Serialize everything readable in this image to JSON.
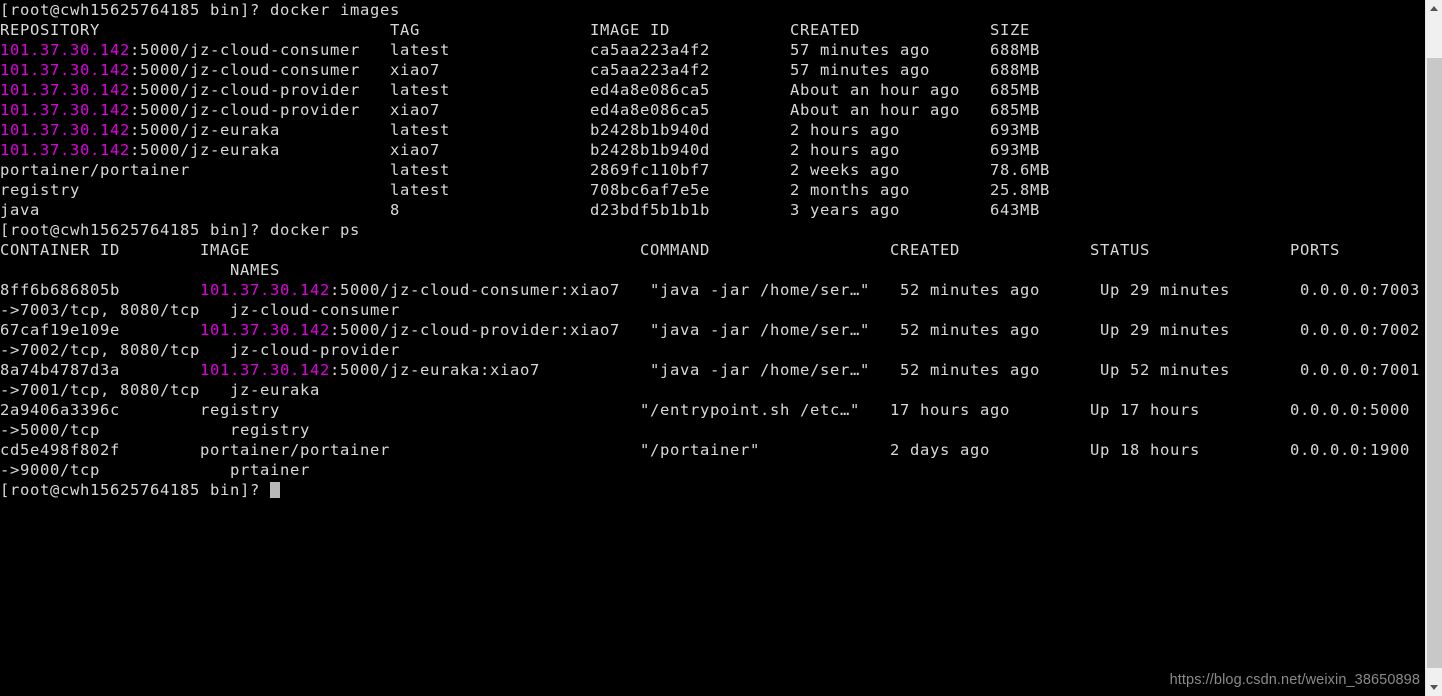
{
  "window": {
    "background_color": "#000000",
    "foreground_color": "#d8d8d8",
    "highlight_color": "#e000e0"
  },
  "watermark": {
    "text": "https://blog.csdn.net/weixin_38650898"
  },
  "scrollbar": {
    "up_arrow": "chevron-up-icon",
    "down_arrow": "chevron-down-icon"
  },
  "terminal": {
    "prompt": "[root@cwh15625764185 bin]?",
    "lines": [
      {
        "id": "cmd-docker-images",
        "segments": [
          {
            "text": "[root@cwh15625764185 bin]? docker images",
            "color": "plain"
          }
        ]
      },
      {
        "id": "images-header",
        "segments": [
          {
            "text": "REPOSITORY                             TAG                 IMAGE ID            CREATED             SIZE",
            "color": "plain"
          }
        ]
      },
      {
        "id": "images-row-1",
        "segments": [
          {
            "text": "101.37.30.142",
            "color": "magenta"
          },
          {
            "text": ":5000/jz-cloud-consumer   latest              ca5aa223a4f2        57 minutes ago      688MB",
            "color": "plain"
          }
        ]
      },
      {
        "id": "images-row-2",
        "segments": [
          {
            "text": "101.37.30.142",
            "color": "magenta"
          },
          {
            "text": ":5000/jz-cloud-consumer   xiao7               ca5aa223a4f2        57 minutes ago      688MB",
            "color": "plain"
          }
        ]
      },
      {
        "id": "images-row-3",
        "segments": [
          {
            "text": "101.37.30.142",
            "color": "magenta"
          },
          {
            "text": ":5000/jz-cloud-provider   latest              ed4a8e086ca5        About an hour ago   685MB",
            "color": "plain"
          }
        ]
      },
      {
        "id": "images-row-4",
        "segments": [
          {
            "text": "101.37.30.142",
            "color": "magenta"
          },
          {
            "text": ":5000/jz-cloud-provider   xiao7               ed4a8e086ca5        About an hour ago   685MB",
            "color": "plain"
          }
        ]
      },
      {
        "id": "images-row-5",
        "segments": [
          {
            "text": "101.37.30.142",
            "color": "magenta"
          },
          {
            "text": ":5000/jz-euraka           latest              b2428b1b940d        2 hours ago         693MB",
            "color": "plain"
          }
        ]
      },
      {
        "id": "images-row-6",
        "segments": [
          {
            "text": "101.37.30.142",
            "color": "magenta"
          },
          {
            "text": ":5000/jz-euraka           xiao7               b2428b1b940d        2 hours ago         693MB",
            "color": "plain"
          }
        ]
      },
      {
        "id": "images-row-7",
        "segments": [
          {
            "text": "portainer/portainer                    latest              2869fc110bf7        2 weeks ago         78.6MB",
            "color": "plain"
          }
        ]
      },
      {
        "id": "images-row-8",
        "segments": [
          {
            "text": "registry                               latest              708bc6af7e5e        2 months ago        25.8MB",
            "color": "plain"
          }
        ]
      },
      {
        "id": "images-row-9",
        "segments": [
          {
            "text": "java                                   8                   d23bdf5b1b1b        3 years ago         643MB",
            "color": "plain"
          }
        ]
      },
      {
        "id": "cmd-docker-ps",
        "segments": [
          {
            "text": "[root@cwh15625764185 bin]? docker ps",
            "color": "plain"
          }
        ]
      },
      {
        "id": "ps-header-1",
        "segments": [
          {
            "text": "CONTAINER ID        IMAGE                                       COMMAND                  CREATED             STATUS              PORTS",
            "color": "plain"
          }
        ]
      },
      {
        "id": "ps-header-2",
        "segments": [
          {
            "text": "                       NAMES",
            "color": "plain"
          }
        ]
      },
      {
        "id": "ps-row-1a",
        "segments": [
          {
            "text": "8ff6b686805b        ",
            "color": "plain"
          },
          {
            "text": "101.37.30.142",
            "color": "magenta"
          },
          {
            "text": ":5000/jz-cloud-consumer:xiao7   \"java -jar /home/ser…\"   52 minutes ago      Up 29 minutes       0.0.0.0:7003",
            "color": "plain"
          }
        ]
      },
      {
        "id": "ps-row-1b",
        "segments": [
          {
            "text": "->7003/tcp, 8080/tcp   jz-cloud-consumer",
            "color": "plain"
          }
        ]
      },
      {
        "id": "ps-row-2a",
        "segments": [
          {
            "text": "67caf19e109e        ",
            "color": "plain"
          },
          {
            "text": "101.37.30.142",
            "color": "magenta"
          },
          {
            "text": ":5000/jz-cloud-provider:xiao7   \"java -jar /home/ser…\"   52 minutes ago      Up 29 minutes       0.0.0.0:7002",
            "color": "plain"
          }
        ]
      },
      {
        "id": "ps-row-2b",
        "segments": [
          {
            "text": "->7002/tcp, 8080/tcp   jz-cloud-provider",
            "color": "plain"
          }
        ]
      },
      {
        "id": "ps-row-3a",
        "segments": [
          {
            "text": "8a74b4787d3a        ",
            "color": "plain"
          },
          {
            "text": "101.37.30.142",
            "color": "magenta"
          },
          {
            "text": ":5000/jz-euraka:xiao7           \"java -jar /home/ser…\"   52 minutes ago      Up 52 minutes       0.0.0.0:7001",
            "color": "plain"
          }
        ]
      },
      {
        "id": "ps-row-3b",
        "segments": [
          {
            "text": "->7001/tcp, 8080/tcp   jz-euraka",
            "color": "plain"
          }
        ]
      },
      {
        "id": "ps-row-4a",
        "segments": [
          {
            "text": "2a9406a3396c        registry                                    \"/entrypoint.sh /etc…\"   17 hours ago        Up 17 hours         0.0.0.0:5000",
            "color": "plain"
          }
        ]
      },
      {
        "id": "ps-row-4b",
        "segments": [
          {
            "text": "->5000/tcp             registry",
            "color": "plain"
          }
        ]
      },
      {
        "id": "ps-row-5a",
        "segments": [
          {
            "text": "cd5e498f802f        portainer/portainer                         \"/portainer\"             2 days ago          Up 18 hours         0.0.0.0:1900",
            "color": "plain"
          }
        ]
      },
      {
        "id": "ps-row-5b",
        "segments": [
          {
            "text": "->9000/tcp             prtainer",
            "color": "plain"
          }
        ]
      },
      {
        "id": "prompt-final",
        "segments": [
          {
            "text": "[root@cwh15625764185 bin]? ",
            "color": "plain"
          }
        ],
        "cursor": true
      }
    ]
  }
}
